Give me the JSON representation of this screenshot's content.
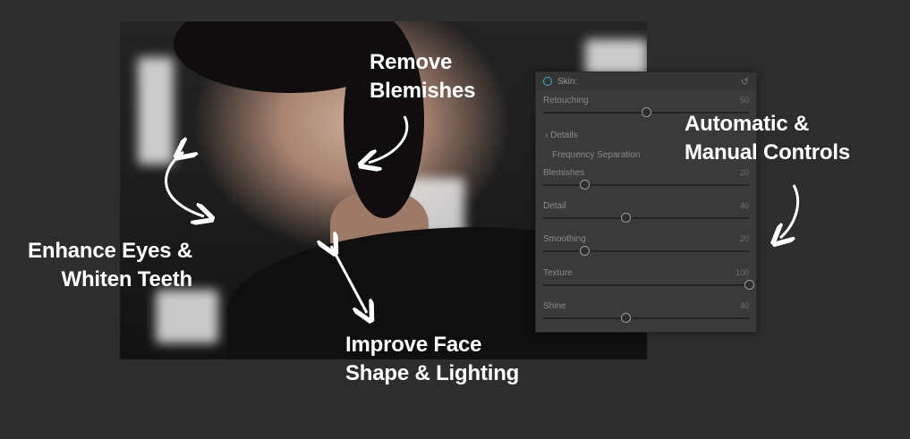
{
  "panel": {
    "title": "Skin:",
    "details_label": "Details",
    "frequency_label": "Frequency Separation",
    "sliders": [
      {
        "label": "Retouching",
        "value": "50",
        "fraction": 0.5
      },
      {
        "label": "Blemishes",
        "value": "20",
        "fraction": 0.2
      },
      {
        "label": "Detail",
        "value": "40",
        "fraction": 0.4
      },
      {
        "label": "Smoothing",
        "value": "20",
        "fraction": 0.2
      },
      {
        "label": "Texture",
        "value": "100",
        "fraction": 1.0
      },
      {
        "label": "Shine",
        "value": "40",
        "fraction": 0.4
      }
    ]
  },
  "annotations": {
    "blemishes": [
      "Remove",
      "Blemishes"
    ],
    "controls": [
      "Automatic &",
      "Manual Controls"
    ],
    "eyes": [
      "Enhance Eyes &",
      "Whiten Teeth"
    ],
    "face": [
      "Improve Face",
      "Shape & Lighting"
    ]
  },
  "colors": {
    "background": "#2d2d2d",
    "panel": "#3a3a3a",
    "accent": "#3fa6c8",
    "text": "#ffffff"
  }
}
